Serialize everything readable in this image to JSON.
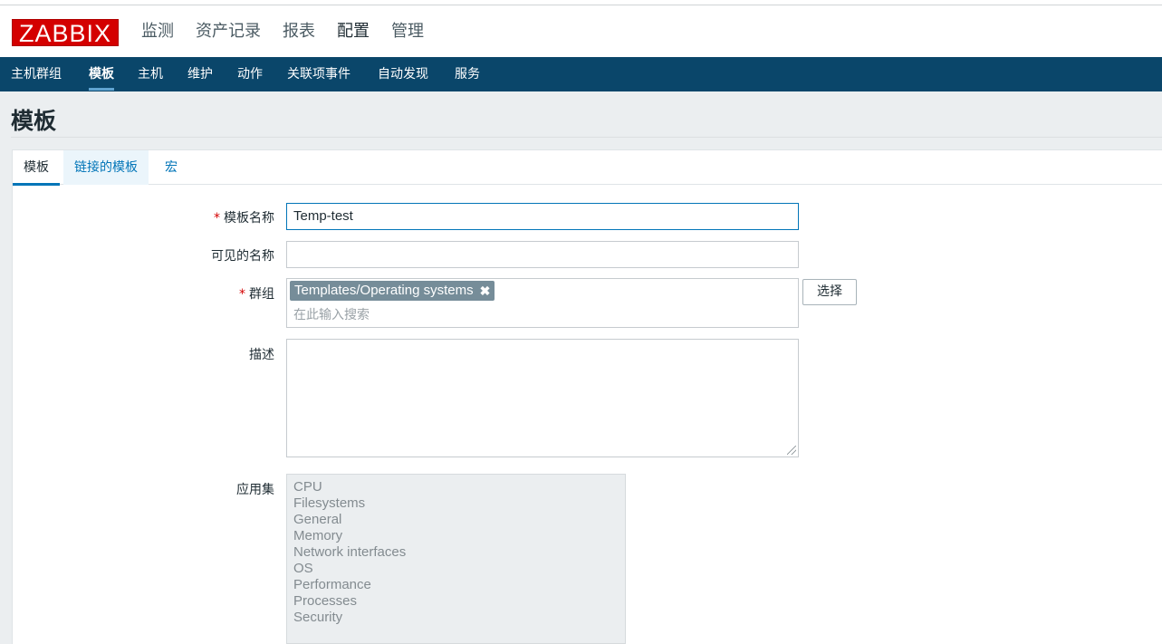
{
  "app": {
    "logo": "ZABBIX"
  },
  "main_menu": [
    {
      "label": "监测",
      "active": false
    },
    {
      "label": "资产记录",
      "active": false
    },
    {
      "label": "报表",
      "active": false
    },
    {
      "label": "配置",
      "active": true
    },
    {
      "label": "管理",
      "active": false
    }
  ],
  "sub_menu": [
    {
      "label": "主机群组",
      "active": false
    },
    {
      "label": "模板",
      "active": true
    },
    {
      "label": "主机",
      "active": false
    },
    {
      "label": "维护",
      "active": false
    },
    {
      "label": "动作",
      "active": false
    },
    {
      "label": "关联项事件",
      "active": false
    },
    {
      "label": "自动发现",
      "active": false
    },
    {
      "label": "服务",
      "active": false
    }
  ],
  "page": {
    "title": "模板"
  },
  "tabs": [
    {
      "label": "模板",
      "active": true
    },
    {
      "label": "链接的模板",
      "active": false
    },
    {
      "label": "宏",
      "active": false
    }
  ],
  "form": {
    "required_mark": "*",
    "template_name": {
      "label": "模板名称",
      "value": "Temp-test"
    },
    "visible_name": {
      "label": "可见的名称",
      "value": ""
    },
    "groups": {
      "label": "群组",
      "selected": [
        "Templates/Operating systems"
      ],
      "remove_icon": "✖",
      "placeholder": "在此输入搜索",
      "select_button": "选择"
    },
    "description": {
      "label": "描述",
      "value": ""
    },
    "applications": {
      "label": "应用集",
      "items": [
        "CPU",
        "Filesystems",
        "General",
        "Memory",
        "Network interfaces",
        "OS",
        "Performance",
        "Processes",
        "Security"
      ]
    }
  },
  "colors": {
    "brand": "#d40000",
    "subnav_bg": "#0a466a",
    "link": "#0275b8",
    "chip_bg": "#768d99"
  }
}
